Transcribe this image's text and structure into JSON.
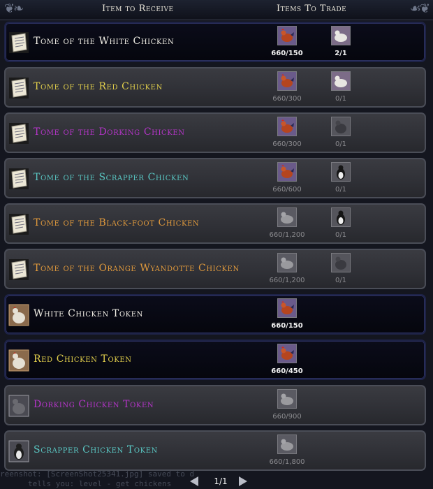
{
  "header": {
    "col_receive": "Item to Receive",
    "col_trade": "Items To Trade"
  },
  "rows": [
    {
      "name": "Tome of the White Chicken",
      "color": "white",
      "icon": "scroll-icon",
      "available": true,
      "trades": [
        {
          "icon": "red-chicken-icon",
          "qty": "660/150"
        },
        {
          "icon": "white-chicken-icon",
          "qty": "2/1"
        }
      ]
    },
    {
      "name": "Tome of the Red Chicken",
      "color": "yellow",
      "icon": "scroll-icon",
      "available": false,
      "trades": [
        {
          "icon": "red-chicken-icon",
          "qty": "660/300"
        },
        {
          "icon": "white-chicken-icon",
          "qty": "0/1"
        }
      ]
    },
    {
      "name": "Tome of the Dorking Chicken",
      "color": "purple",
      "icon": "scroll-icon",
      "available": false,
      "trades": [
        {
          "icon": "red-chicken-icon",
          "qty": "660/300"
        },
        {
          "icon": "dark-chicken-icon",
          "qty": "0/1"
        }
      ]
    },
    {
      "name": "Tome of the Scrapper Chicken",
      "color": "cyan",
      "icon": "scroll-icon",
      "available": false,
      "trades": [
        {
          "icon": "red-chicken-icon",
          "qty": "660/600"
        },
        {
          "icon": "penguin-chicken-icon",
          "qty": "0/1"
        }
      ]
    },
    {
      "name": "Tome of the Black-foot Chicken",
      "color": "orange",
      "icon": "scroll-icon",
      "available": false,
      "trades": [
        {
          "icon": "grey-chicken-icon",
          "qty": "660/1,200"
        },
        {
          "icon": "penguin-chicken-icon",
          "qty": "0/1"
        }
      ]
    },
    {
      "name": "Tome of the Orange Wyandotte Chicken",
      "color": "orange",
      "icon": "scroll-icon",
      "available": false,
      "trades": [
        {
          "icon": "grey-chicken-icon",
          "qty": "660/1,200"
        },
        {
          "icon": "dark-chicken-icon",
          "qty": "0/1"
        }
      ]
    },
    {
      "name": "White Chicken Token",
      "color": "white",
      "icon": "white-chicken-token-icon",
      "available": true,
      "trades": [
        {
          "icon": "red-chicken-icon",
          "qty": "660/150"
        }
      ]
    },
    {
      "name": "Red Chicken Token",
      "color": "yellow",
      "icon": "white-chicken-token-icon",
      "available": true,
      "trades": [
        {
          "icon": "red-chicken-icon",
          "qty": "660/450"
        }
      ]
    },
    {
      "name": "Dorking Chicken Token",
      "color": "purple",
      "icon": "dark-chicken-token-icon",
      "available": false,
      "trades": [
        {
          "icon": "grey-chicken-icon",
          "qty": "660/900"
        }
      ]
    },
    {
      "name": "Scrapper Chicken Token",
      "color": "cyan",
      "icon": "penguin-chicken-token-icon",
      "available": false,
      "trades": [
        {
          "icon": "grey-chicken-icon",
          "qty": "660/1,800"
        }
      ]
    }
  ],
  "footer": {
    "page_label": "1/1",
    "chat_line_1": "reenshot: [ScreenShot25341.jpg] saved to d",
    "chat_line_2": "tells you: level - get chickens"
  }
}
